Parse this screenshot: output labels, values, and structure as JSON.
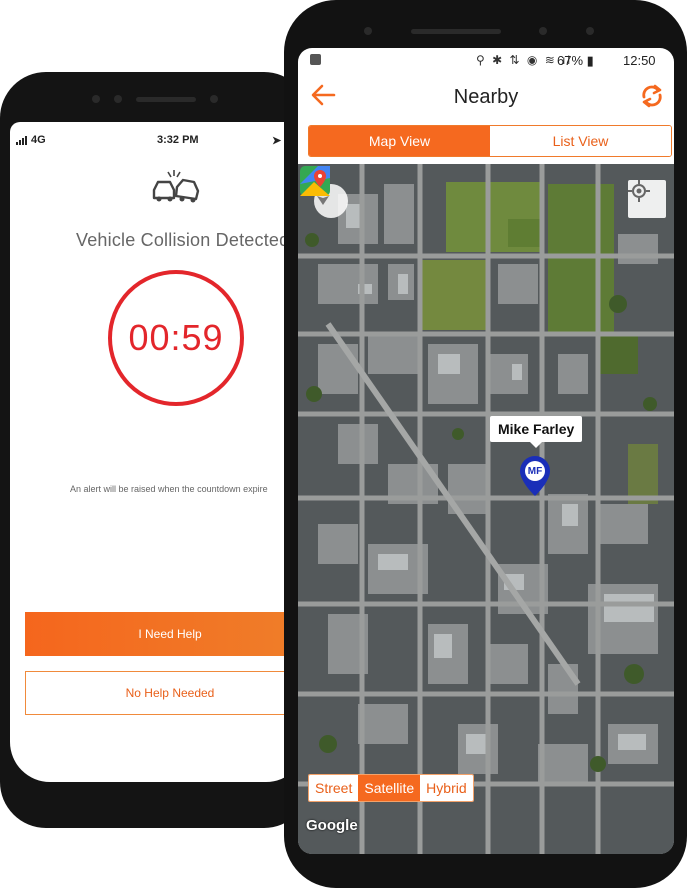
{
  "collision_screen": {
    "status": {
      "network": "4G",
      "time": "3:32 PM"
    },
    "icon": "car-collision-icon",
    "title": "Vehicle Collision Detected",
    "countdown": "00:59",
    "alert_text": "An alert will be raised when the countdown expire",
    "buttons": {
      "need_help": "I Need Help",
      "no_help": "No Help Needed"
    }
  },
  "nearby_screen": {
    "status": {
      "icons": "⚲ ✱ ⇅ ◉ ≋ ıl",
      "battery": "67%",
      "time": "12:50"
    },
    "header": {
      "title": "Nearby",
      "back_icon": "back-arrow-icon",
      "refresh_icon": "refresh-icon"
    },
    "tabs": {
      "map_view": "Map View",
      "list_view": "List View",
      "active": "map_view"
    },
    "map": {
      "marker": {
        "name": "Mike Farley",
        "initials": "MF"
      },
      "map_types": [
        "Street",
        "Satellite",
        "Hybrid"
      ],
      "selected_type": "Satellite",
      "attribution": "Google"
    }
  },
  "colors": {
    "accent": "#f5691f",
    "danger": "#e3262b",
    "marker": "#1a2eb8"
  }
}
